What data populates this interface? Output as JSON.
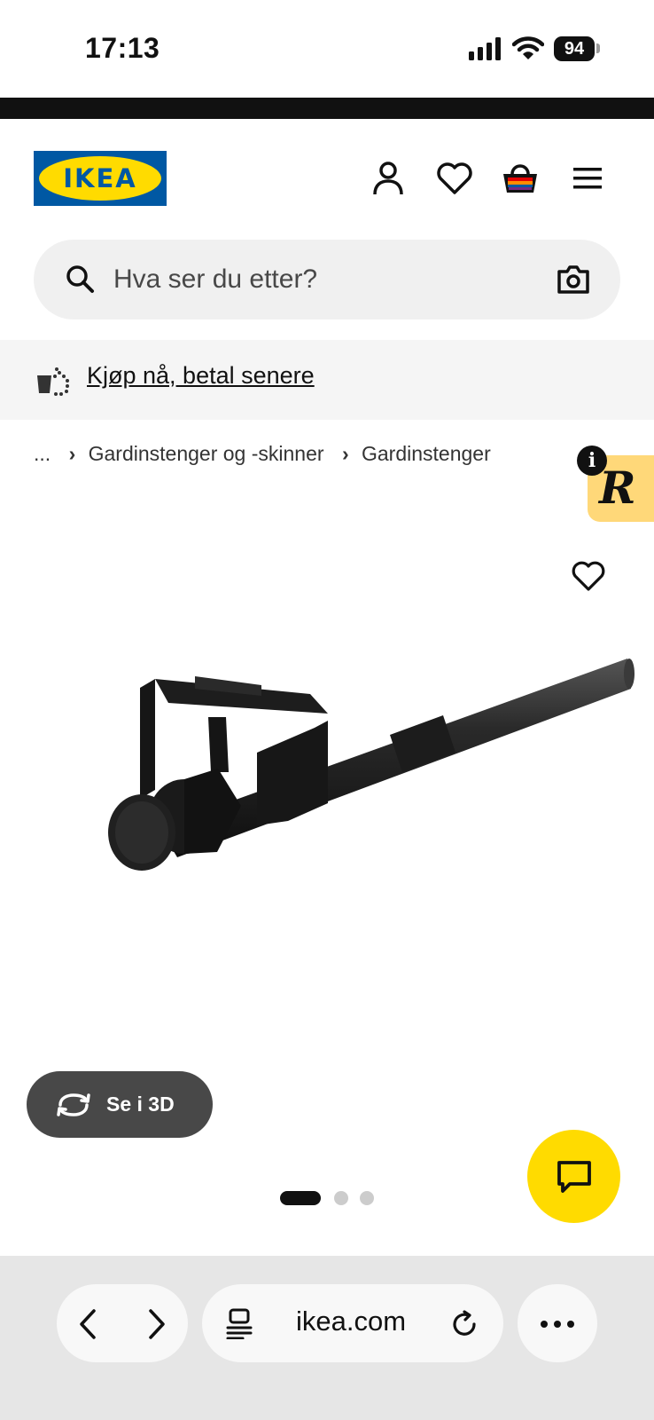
{
  "status_bar": {
    "time": "17:13",
    "battery": "94"
  },
  "header": {
    "logo_text": "IKEA"
  },
  "search": {
    "placeholder": "Hva ser du etter?"
  },
  "promo": {
    "text": "Kjøp nå, betal senere"
  },
  "breadcrumb": {
    "ellipsis": "...",
    "items": [
      "Gardinstenger og -skinner",
      "Gardinstenger"
    ]
  },
  "badge": {
    "letter": "R",
    "info": "i"
  },
  "product": {
    "view_3d_label": "Se i 3D",
    "carousel": {
      "total": 3,
      "active": 1
    }
  },
  "browser": {
    "url": "ikea.com"
  },
  "colors": {
    "ikea_blue": "#0058a3",
    "ikea_yellow": "#ffdb00",
    "badge_bg": "#ffd879"
  }
}
